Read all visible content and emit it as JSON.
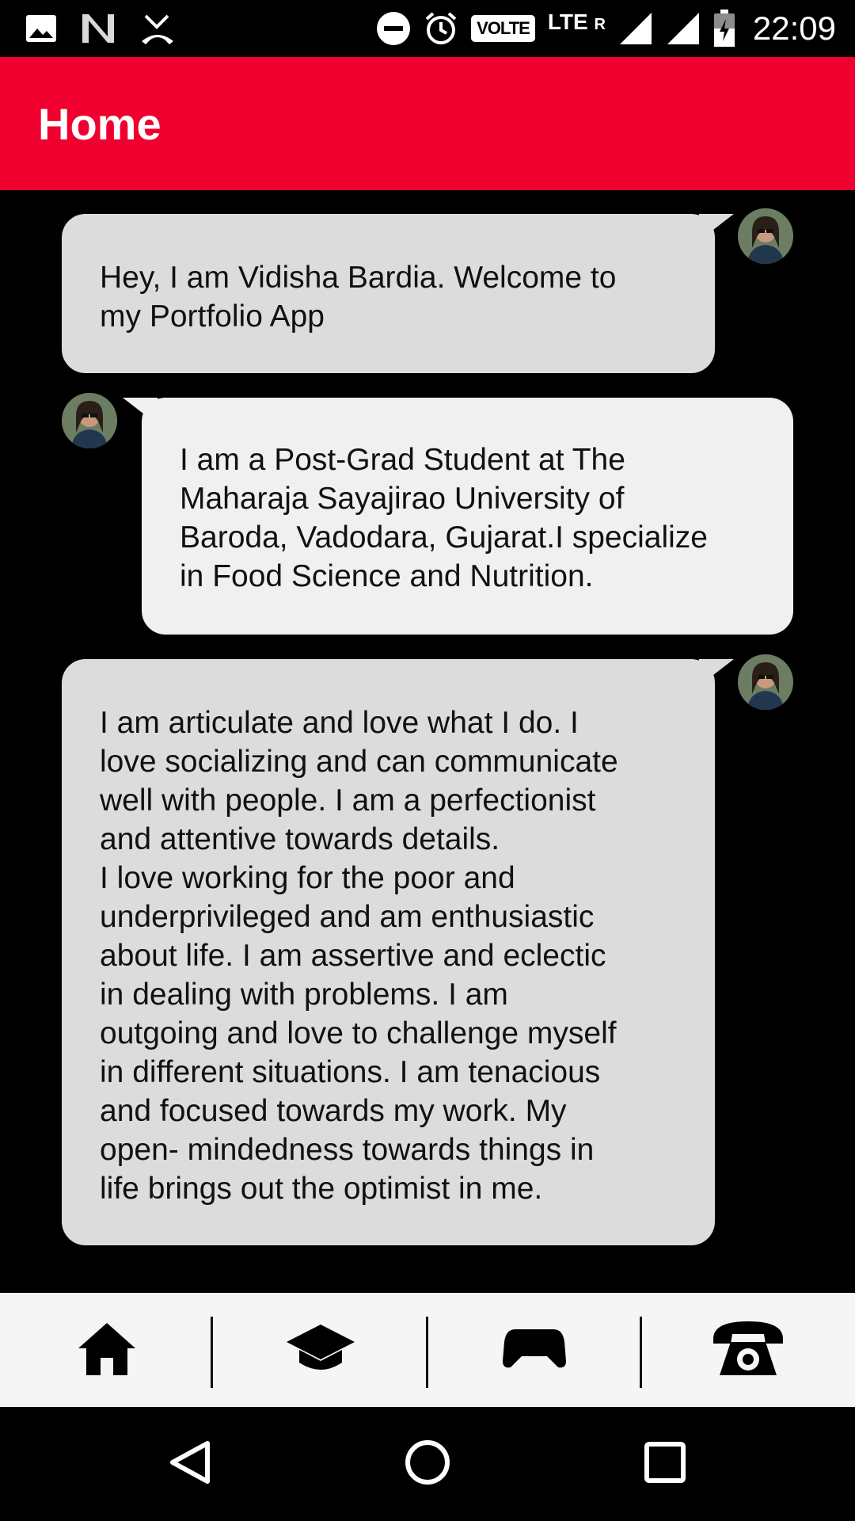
{
  "status_bar": {
    "time": "22:09",
    "network": "LTE",
    "roaming": "R",
    "volte": "VOLTE",
    "left_icons": [
      "image-icon",
      "n-icon",
      "missed-call-icon"
    ],
    "right_icons": [
      "do-not-disturb-icon",
      "alarm-icon",
      "volte-icon",
      "lte-icon",
      "signal-icon",
      "signal-icon",
      "battery-icon"
    ]
  },
  "app_bar": {
    "title": "Home"
  },
  "messages": [
    {
      "side": "right",
      "text": "Hey, I am Vidisha Bardia. Welcome to\nmy Portfolio App"
    },
    {
      "side": "left",
      "text": "I am a Post-Grad Student at The\nMaharaja Sayajirao University of\nBaroda, Vadodara, Gujarat.I specialize\nin Food Science and Nutrition."
    },
    {
      "side": "right",
      "text": "I am articulate and love what I do. I\nlove socializing and can communicate\nwell with people. I am a perfectionist\nand attentive towards details.\nI love working for the poor and\nunderprivileged and am enthusiastic\nabout life. I am assertive and eclectic\nin dealing with problems. I am\noutgoing and love to challenge myself\nin different situations. I am tenacious\nand focused towards my work. My\nopen- mindedness towards things in\nlife brings out the optimist in me."
    }
  ],
  "bottom_nav": {
    "items": [
      "home-icon",
      "graduation-cap-icon",
      "gamepad-icon",
      "telephone-icon"
    ]
  },
  "system_nav": {
    "items": [
      "back-icon",
      "home-circle-icon",
      "recents-icon"
    ]
  },
  "colors": {
    "accent": "#f0002e",
    "bubble_right": "#dcdcdc",
    "bubble_left": "#f0f0f0",
    "nav_bg": "#f5f5f5"
  }
}
